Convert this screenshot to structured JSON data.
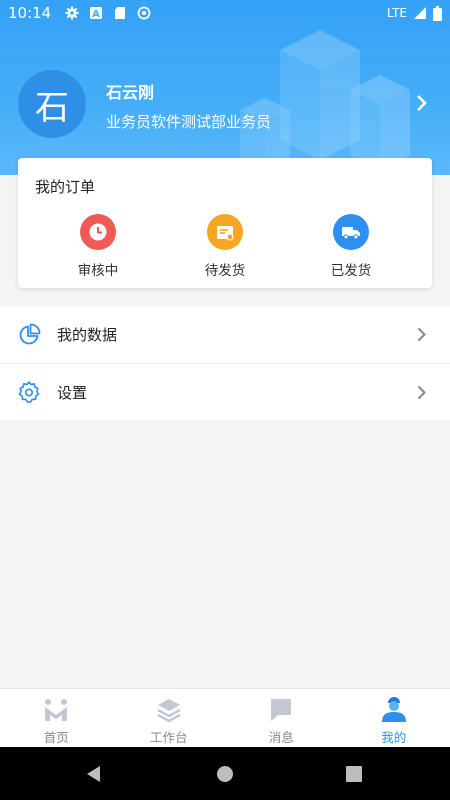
{
  "status_bar": {
    "time": "10:14",
    "network": "LTE",
    "icons": [
      "gear-icon",
      "a-icon",
      "sd-card-icon",
      "sync-icon",
      "signal-icon",
      "battery-icon"
    ]
  },
  "profile": {
    "avatar_text": "石",
    "name": "石云刚",
    "title": "业务员软件测试部业务员"
  },
  "orders": {
    "title": "我的订单",
    "items": [
      {
        "label": "审核中",
        "icon": "clock-icon",
        "color": "#f05a54"
      },
      {
        "label": "待发货",
        "icon": "package-icon",
        "color": "#f6a623"
      },
      {
        "label": "已发货",
        "icon": "truck-icon",
        "color": "#2d8ff0"
      }
    ]
  },
  "menu": [
    {
      "label": "我的数据",
      "icon": "pie-chart-icon"
    },
    {
      "label": "设置",
      "icon": "gear-icon"
    }
  ],
  "tabs": [
    {
      "label": "首页",
      "icon": "home-m-icon",
      "active": false
    },
    {
      "label": "工作台",
      "icon": "layers-icon",
      "active": false
    },
    {
      "label": "消息",
      "icon": "message-icon",
      "active": false
    },
    {
      "label": "我的",
      "icon": "person-icon",
      "active": true
    }
  ],
  "colors": {
    "brand_blue": "#2d8ff0",
    "header_blue": "#3ea7f7",
    "inactive_gray": "#c2c8d2"
  }
}
